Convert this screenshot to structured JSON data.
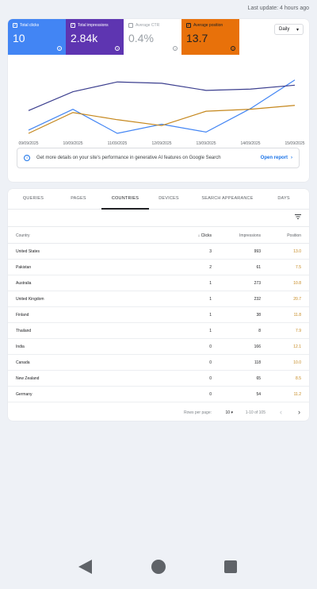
{
  "header": {
    "last_update": "Last update: 4 hours ago"
  },
  "metrics": {
    "clicks": {
      "label": "Total clicks",
      "value": "10",
      "checked": true
    },
    "impressions": {
      "label": "Total impressions",
      "value": "2.84k",
      "checked": true
    },
    "ctr": {
      "label": "Average CTR",
      "value": "0.4%",
      "checked": false
    },
    "position": {
      "label": "Average position",
      "value": "13.7",
      "checked": true
    }
  },
  "period": {
    "selected": "Daily"
  },
  "chart_data": {
    "type": "line",
    "categories": [
      "09/09/2025",
      "10/09/2025",
      "11/09/2025",
      "12/09/2025",
      "13/09/2025",
      "14/09/2025",
      "15/09/2025"
    ],
    "series": [
      {
        "name": "Total clicks",
        "color": "#4285f4",
        "values": [
          0.05,
          0.37,
          0.0,
          0.14,
          0.02,
          0.38,
          0.82
        ]
      },
      {
        "name": "Total impressions",
        "color": "#3c3f8f",
        "values": [
          0.35,
          0.64,
          0.79,
          0.77,
          0.66,
          0.68,
          0.74
        ]
      },
      {
        "name": "Average position",
        "color": "#c5871c",
        "values": [
          0.0,
          0.32,
          0.21,
          0.12,
          0.34,
          0.37,
          0.43
        ]
      }
    ],
    "grid": false
  },
  "banner": {
    "text": "Get more details on your site's performance in generative AI features on Google Search",
    "action": "Open report"
  },
  "tabs": [
    "QUERIES",
    "PAGES",
    "COUNTRIES",
    "DEVICES",
    "SEARCH APPEARANCE",
    "DAYS"
  ],
  "active_tab": "COUNTRIES",
  "table": {
    "headers": {
      "country": "Country",
      "clicks": "Clicks",
      "impressions": "Impressions",
      "position": "Position"
    },
    "rows": [
      {
        "country": "United States",
        "clicks": "3",
        "impressions": "993",
        "position": "13.0"
      },
      {
        "country": "Pakistan",
        "clicks": "2",
        "impressions": "61",
        "position": "7.5"
      },
      {
        "country": "Australia",
        "clicks": "1",
        "impressions": "273",
        "position": "10.8"
      },
      {
        "country": "United Kingdom",
        "clicks": "1",
        "impressions": "232",
        "position": "20.7"
      },
      {
        "country": "Finland",
        "clicks": "1",
        "impressions": "38",
        "position": "11.8"
      },
      {
        "country": "Thailand",
        "clicks": "1",
        "impressions": "8",
        "position": "7.9"
      },
      {
        "country": "India",
        "clicks": "0",
        "impressions": "166",
        "position": "12.1"
      },
      {
        "country": "Canada",
        "clicks": "0",
        "impressions": "118",
        "position": "10.0"
      },
      {
        "country": "New Zealand",
        "clicks": "0",
        "impressions": "65",
        "position": "8.5"
      },
      {
        "country": "Germany",
        "clicks": "0",
        "impressions": "54",
        "position": "11.2"
      }
    ]
  },
  "pagination": {
    "rows_per_page_label": "Rows per page:",
    "rows_per_page": "10",
    "range": "1-10 of 105"
  },
  "icons": {
    "filter": "filter-icon",
    "sort": "arrow-down-icon",
    "dropdown": "chevron-down-icon"
  },
  "colors": {
    "clicks": "#4285f4",
    "impressions": "#5e35b1",
    "position": "#e8710a",
    "link": "#1a73e8"
  }
}
